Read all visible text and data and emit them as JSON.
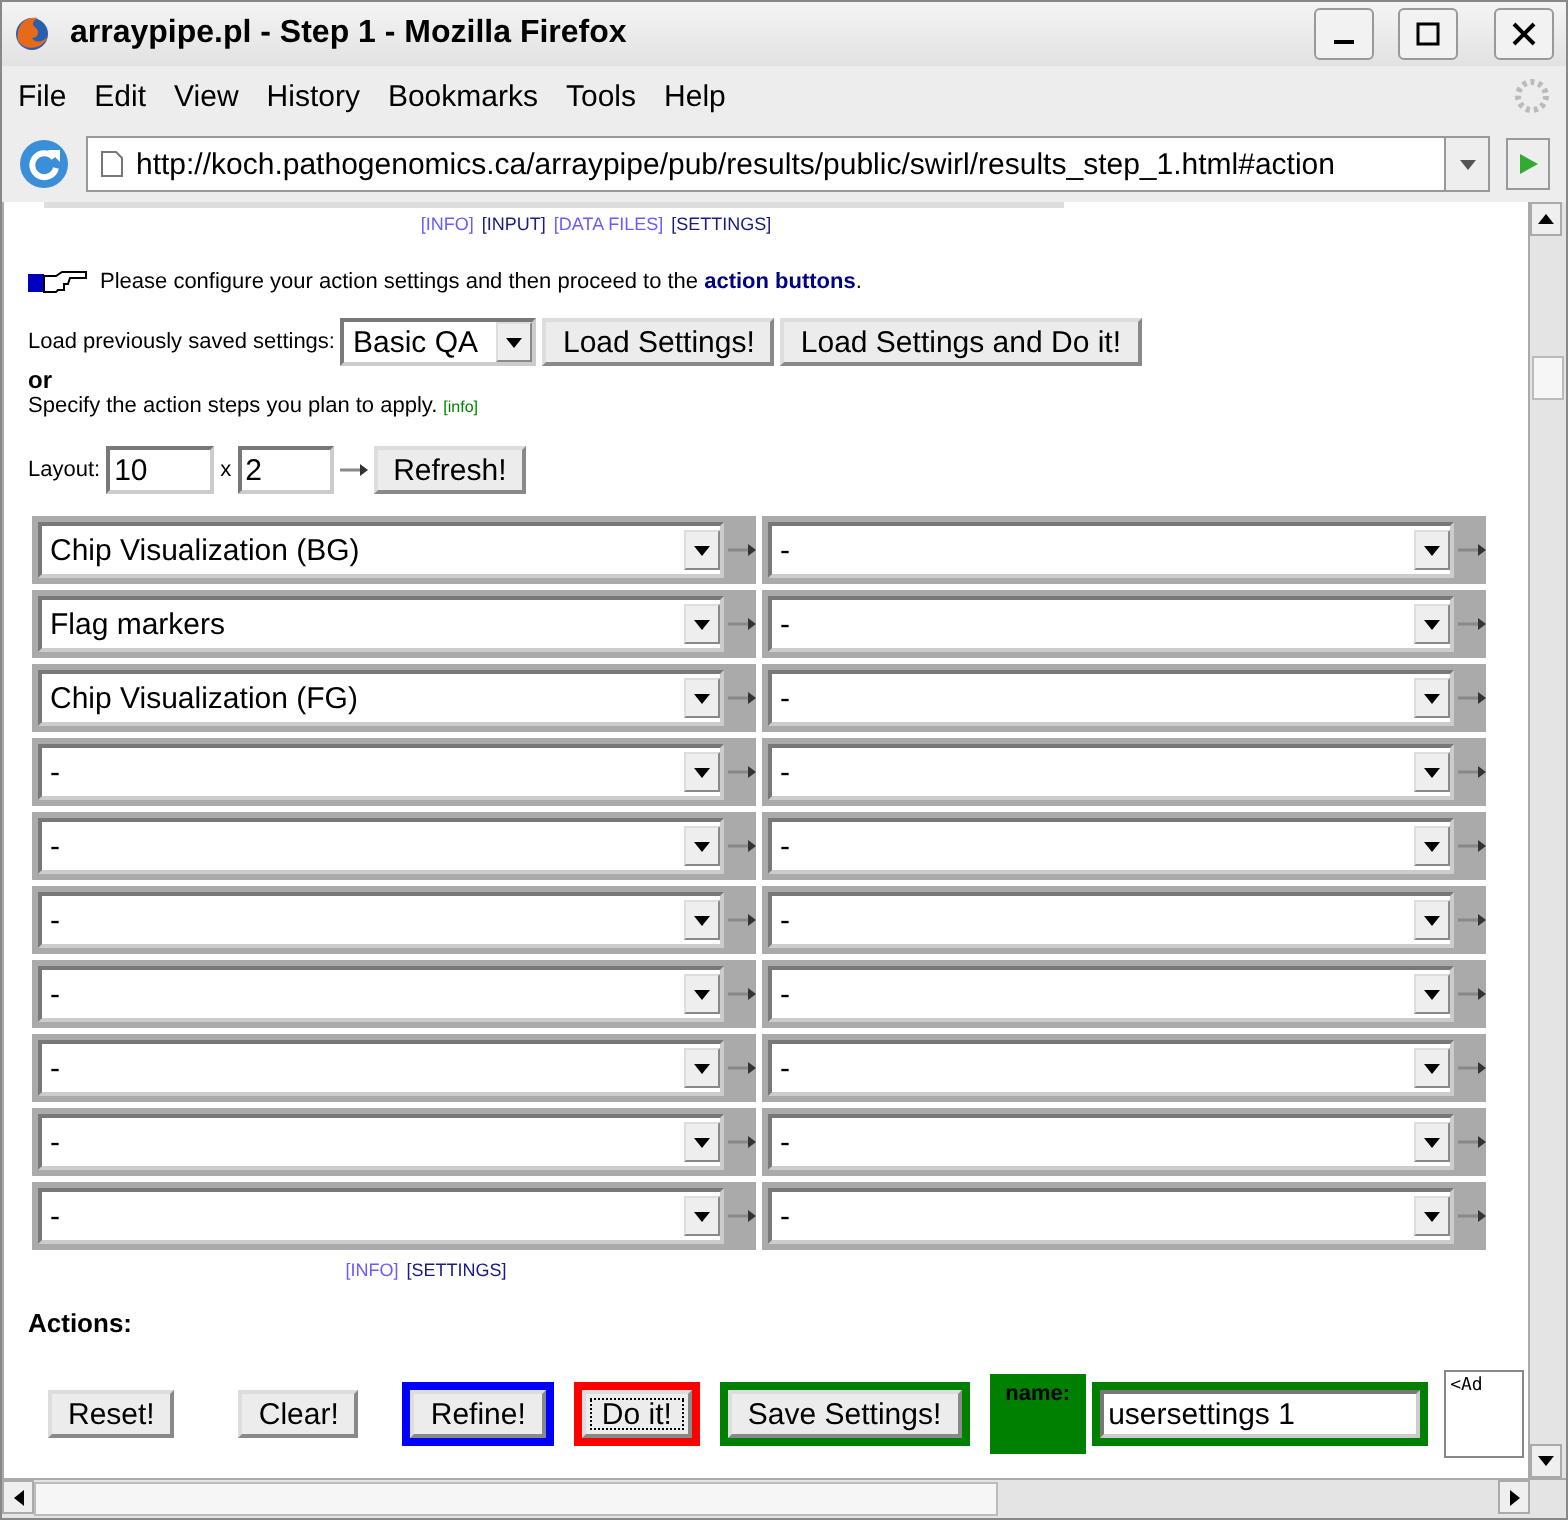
{
  "window": {
    "title": "arraypipe.pl - Step 1 - Mozilla Firefox"
  },
  "menu": [
    {
      "label": "File"
    },
    {
      "label": "Edit"
    },
    {
      "label": "View"
    },
    {
      "label": "History"
    },
    {
      "label": "Bookmarks"
    },
    {
      "label": "Tools"
    },
    {
      "label": "Help"
    }
  ],
  "address_bar": {
    "url": "http://koch.pathogenomics.ca/arraypipe/pub/results/public/swirl/results_step_1.html#action"
  },
  "top_links": [
    {
      "label": "[INFO]",
      "visited": false
    },
    {
      "label": "[INPUT]",
      "visited": true
    },
    {
      "label": "[DATA FILES]",
      "visited": false
    },
    {
      "label": "[SETTINGS]",
      "visited": true
    }
  ],
  "intro": "Please configure your action settings and then proceed to the **action buttons**.",
  "load": {
    "label": "Load previously saved settings:",
    "preset": "Basic QA",
    "buttons": [
      "Load Settings!",
      "Load Settings and Do it!"
    ]
  },
  "or": "or",
  "specify": {
    "text": "Specify the action steps you plan to apply.",
    "info": "[info]"
  },
  "layout": {
    "label": "Layout:",
    "rows": "10",
    "separator": "x",
    "cols": "2",
    "button": "Refresh!"
  },
  "steps": [
    [
      "Chip Visualization (BG)",
      "-"
    ],
    [
      "Flag markers",
      "-"
    ],
    [
      "Chip Visualization (FG)",
      "-"
    ],
    [
      "-",
      "-"
    ],
    [
      "-",
      "-"
    ],
    [
      "-",
      "-"
    ],
    [
      "-",
      "-"
    ],
    [
      "-",
      "-"
    ],
    [
      "-",
      "-"
    ],
    [
      "-",
      "-"
    ]
  ],
  "bottom_links": [
    {
      "label": "[INFO]",
      "visited": false
    },
    {
      "label": "[SETTINGS]",
      "visited": true
    }
  ],
  "actions": {
    "title": "Actions:",
    "buttons": [
      {
        "label": "Reset!",
        "focused": false
      },
      {
        "label": "Clear!",
        "focused": false
      },
      {
        "label": "Refine!",
        "color": "#0000ff",
        "focused": false
      },
      {
        "label": "Do it!",
        "color": "#ff0000",
        "focused": true
      },
      {
        "label": "Save Settings!",
        "color": "#008000",
        "focused": false
      }
    ]
  },
  "name_field": {
    "label": "name:",
    "value": "usersettings 1"
  },
  "notes": {
    "text": "<Ad"
  }
}
